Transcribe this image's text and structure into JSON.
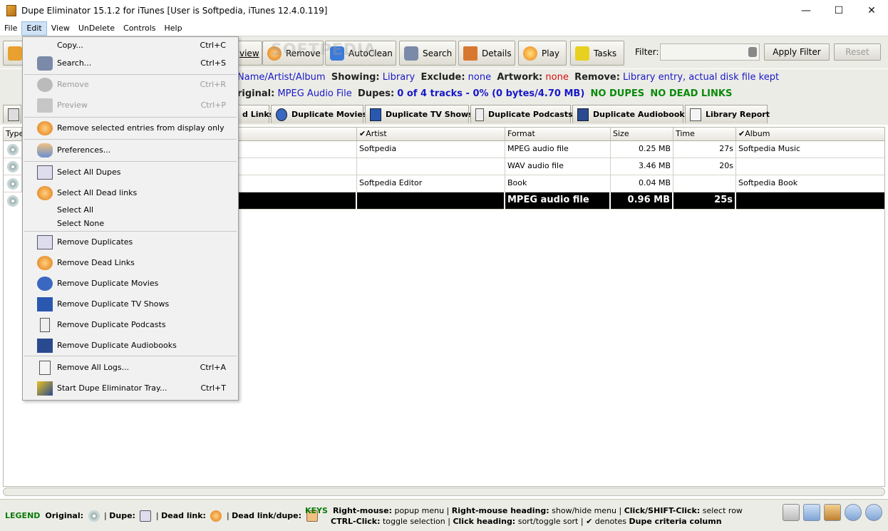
{
  "window": {
    "title": "Dupe Eliminator 15.1.2 for iTunes  [User is Softpedia, iTunes 12.4.0.119]",
    "minimize": "—",
    "maximize": "☐",
    "close": "✕"
  },
  "menubar": [
    "File",
    "Edit",
    "View",
    "UnDelete",
    "Controls",
    "Help"
  ],
  "toolbar": {
    "view_partial": "view",
    "remove": "Remove",
    "autoclean": "AutoClean",
    "search": "Search",
    "details": "Details",
    "play": "Play",
    "tasks": "Tasks",
    "filter_label": "Filter:",
    "filter_value": "",
    "apply_filter": "Apply Filter",
    "reset": "Reset"
  },
  "info1": {
    "a": "Name/Artist/Album",
    "showing_label": "Showing:",
    "showing": "Library",
    "exclude_label": "Exclude:",
    "exclude": "none",
    "artwork_label": "Artwork:",
    "artwork": "none",
    "remove_label": "Remove:",
    "remove": "Library entry, actual disk file kept"
  },
  "info2": {
    "original_label": "riginal:",
    "original": "MPEG Audio File",
    "dupes_label": "Dupes:",
    "dupes": "0 of 4 tracks - 0% (0 bytes/4.70 MB)",
    "no_dupes": "NO DUPES",
    "no_dead": "NO DEAD LINKS"
  },
  "tabs": {
    "dead_links_partial": "d Links",
    "movies": "Duplicate Movies",
    "tv": "Duplicate TV Shows",
    "podcasts": "Duplicate Podcasts",
    "audiobooks": "Duplicate Audiobooks",
    "report": "Library Report"
  },
  "table": {
    "headers": {
      "type": "Type",
      "artist": "✔Artist",
      "format": "Format",
      "size": "Size",
      "time": "Time",
      "album": "✔Album"
    },
    "rows": [
      {
        "artist": "Softpedia",
        "format": "MPEG audio file",
        "size": "0.25 MB",
        "time": "27s",
        "album": "Softpedia Music"
      },
      {
        "artist": "",
        "format": "WAV audio file",
        "size": "3.46 MB",
        "time": "20s",
        "album": ""
      },
      {
        "artist": "Softpedia Editor",
        "format": "Book",
        "size": "0.04 MB",
        "time": "",
        "album": "Softpedia Book"
      },
      {
        "artist": "",
        "format": "MPEG audio file",
        "size": "0.96 MB",
        "time": "25s",
        "album": ""
      }
    ]
  },
  "edit_menu": {
    "copy": "Copy...",
    "copy_sc": "Ctrl+C",
    "search": "Search...",
    "search_sc": "Ctrl+S",
    "remove": "Remove",
    "remove_sc": "Ctrl+R",
    "preview": "Preview",
    "preview_sc": "Ctrl+P",
    "remove_display": "Remove selected entries from display only",
    "preferences": "Preferences...",
    "select_all_dupes": "Select All Dupes",
    "select_all_dead": "Select All Dead links",
    "select_all": "Select All",
    "select_none": "Select None",
    "remove_duplicates": "Remove Duplicates",
    "remove_dead_links": "Remove Dead Links",
    "remove_dup_movies": "Remove Duplicate Movies",
    "remove_dup_tv": "Remove Duplicate TV Shows",
    "remove_dup_podcasts": "Remove Duplicate Podcasts",
    "remove_dup_audiobooks": "Remove Duplicate Audiobooks",
    "remove_all_logs": "Remove All Logs...",
    "remove_all_logs_sc": "Ctrl+A",
    "start_tray": "Start Dupe Eliminator Tray...",
    "start_tray_sc": "Ctrl+T"
  },
  "legend": {
    "title": "LEGEND",
    "original": "Original:",
    "dupe": "Dupe:",
    "dead_link": "Dead link:",
    "dead_link_dupe": "Dead link/dupe:"
  },
  "keys": {
    "title": "KEYS",
    "right_mouse": "Right-mouse:",
    "right_mouse_v": "popup menu",
    "right_heading": "Right-mouse heading:",
    "right_heading_v": "show/hide menu",
    "click_shift": "Click/SHIFT-Click:",
    "click_shift_v": "select row",
    "ctrl_click": "CTRL-Click:",
    "ctrl_click_v": "toggle selection",
    "click_heading": "Click heading:",
    "click_heading_v": "sort/toggle sort",
    "denotes": "✔ denotes",
    "criteria": "Dupe criteria column"
  },
  "watermark": "SOFTPEDIA"
}
